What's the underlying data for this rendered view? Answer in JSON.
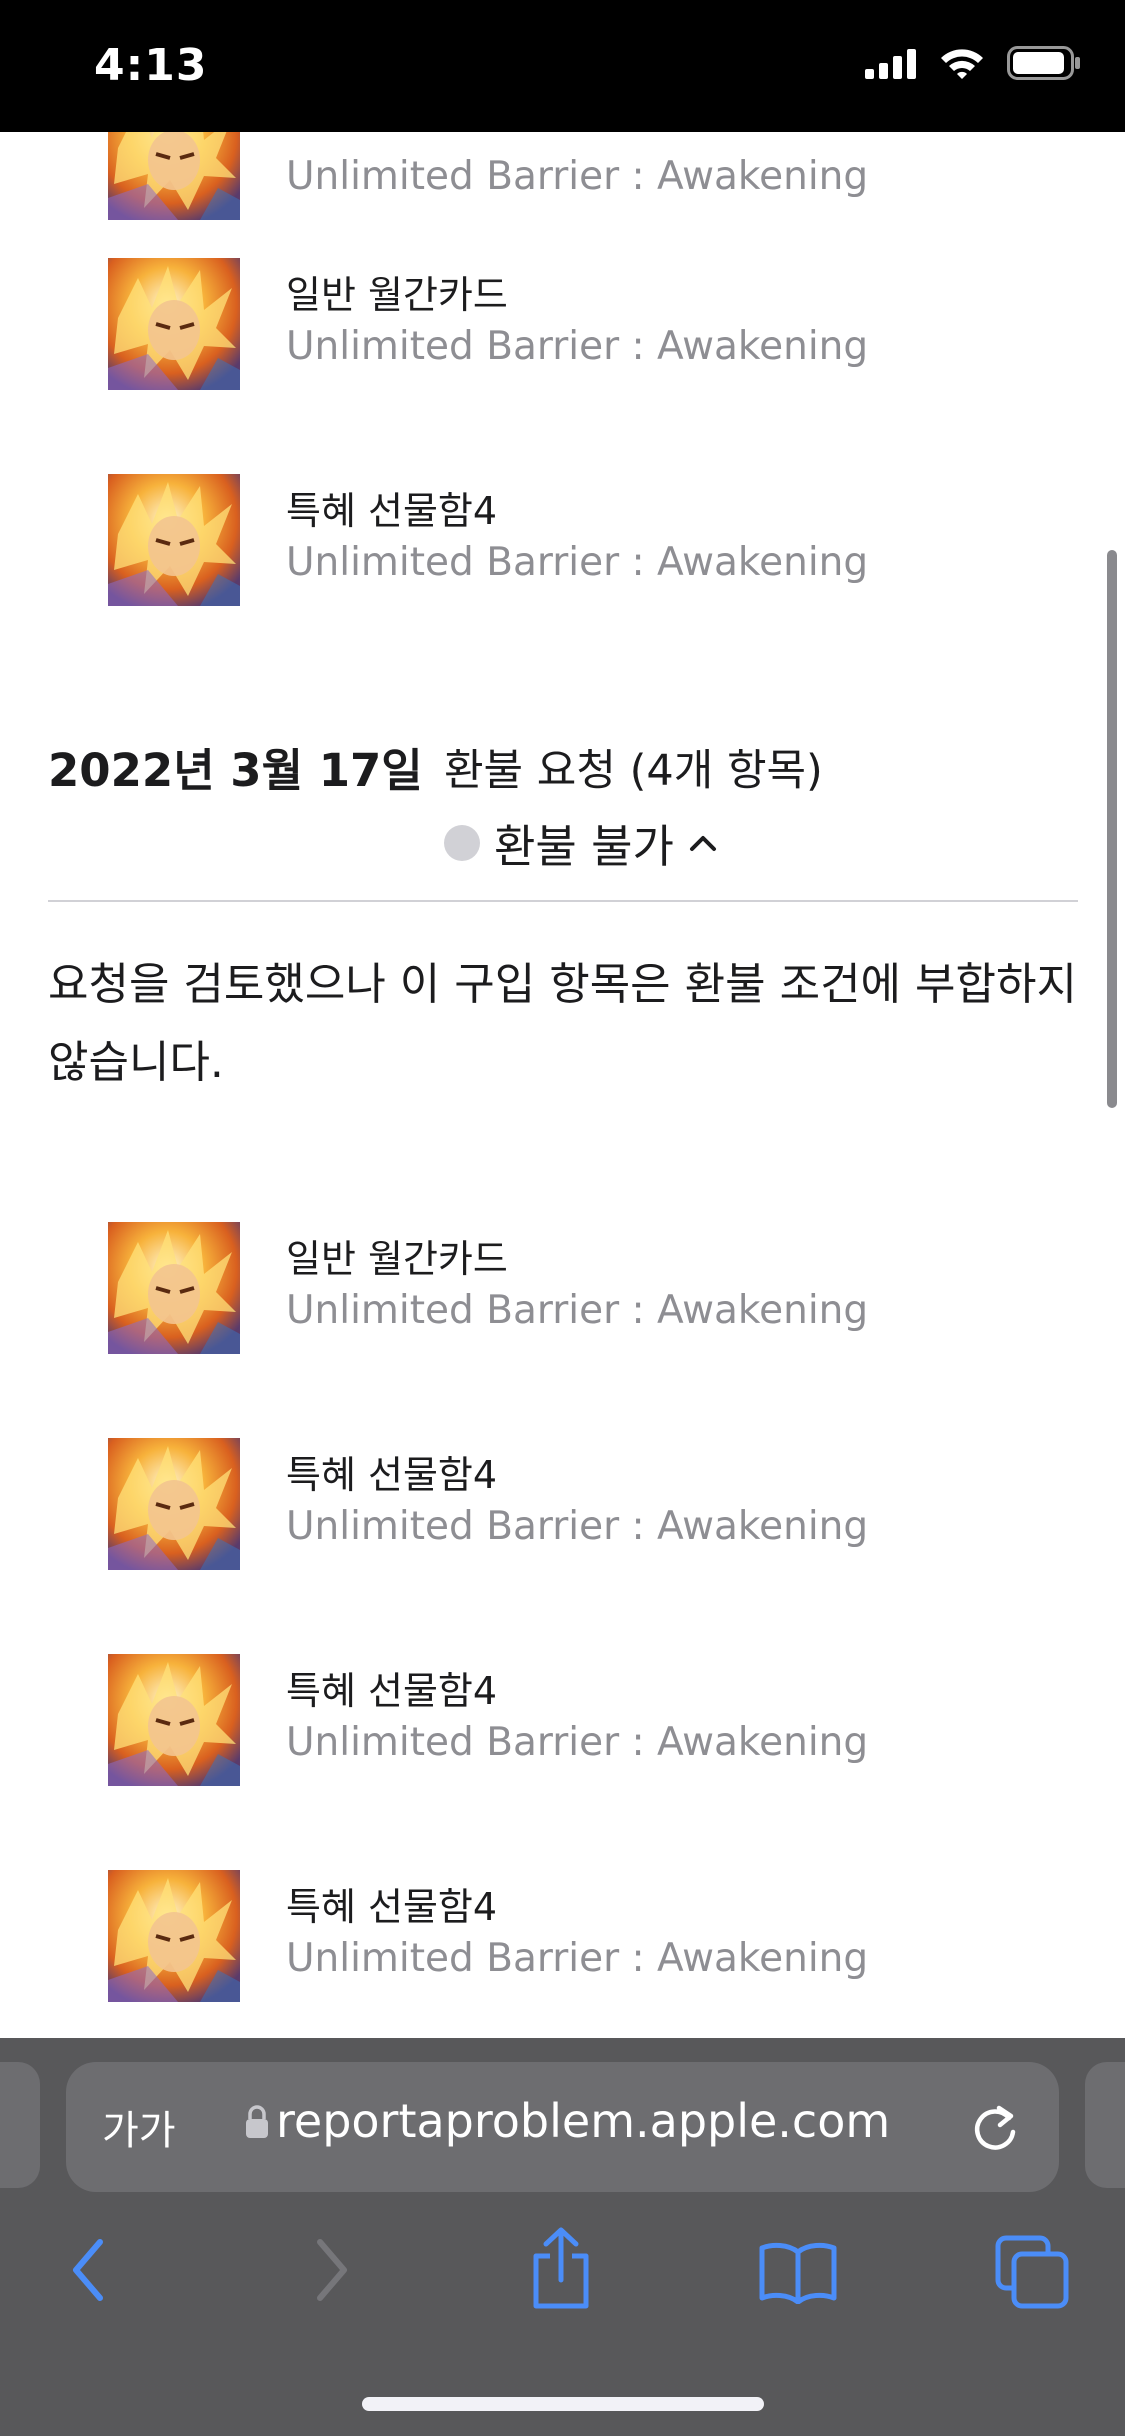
{
  "status_bar": {
    "time": "4:13"
  },
  "colors": {
    "accent": "#4b8df8",
    "secondary_text": "#8e8e93",
    "toolbar": "#58585a",
    "status_dot": "#d1d1d6"
  },
  "items_top": [
    {
      "title": "",
      "subtitle": "Unlimited Barrier : Awakening"
    },
    {
      "title": "일반 월간카드",
      "subtitle": "Unlimited Barrier : Awakening"
    },
    {
      "title": "특혜 선물함4",
      "subtitle": "Unlimited Barrier : Awakening"
    }
  ],
  "refund_request": {
    "date": "2022년 3월 17일",
    "title": "환불 요청 (4개 항목)",
    "status": "환불 불가",
    "status_icon": "chevron-up-icon",
    "message": "요청을 검토했으나 이 구입 항목은 환불 조건에 부합하지 않습니다."
  },
  "items_bottom": [
    {
      "title": "일반 월간카드",
      "subtitle": "Unlimited Barrier : Awakening"
    },
    {
      "title": "특혜 선물함4",
      "subtitle": "Unlimited Barrier : Awakening"
    },
    {
      "title": "특혜 선물함4",
      "subtitle": "Unlimited Barrier : Awakening"
    },
    {
      "title": "특혜 선물함4",
      "subtitle": "Unlimited Barrier : Awakening"
    }
  ],
  "browser": {
    "aa_label": "가가",
    "url": "reportaproblem.apple.com",
    "icons": [
      "lock-icon",
      "reload-icon",
      "back-icon",
      "forward-icon",
      "share-icon",
      "bookmarks-icon",
      "tabs-icon"
    ]
  }
}
